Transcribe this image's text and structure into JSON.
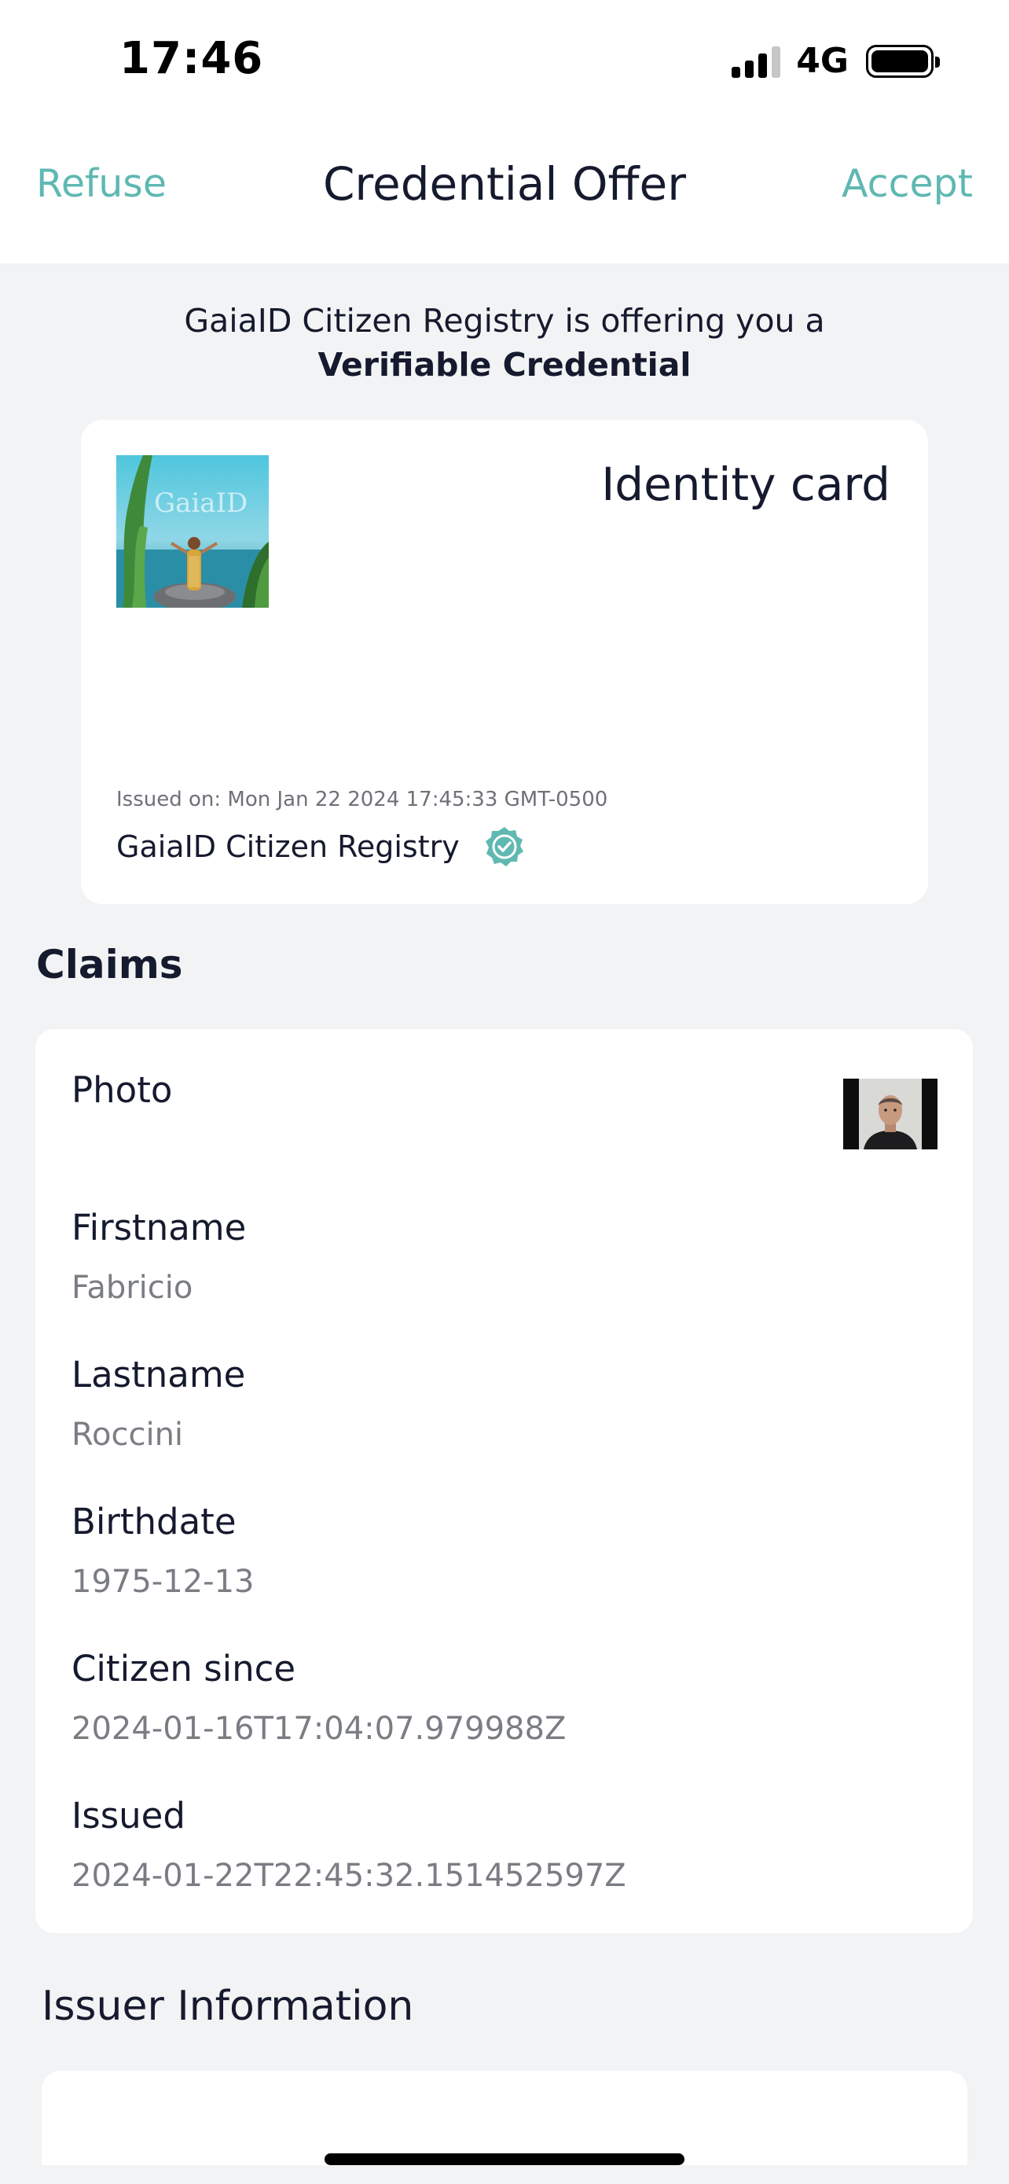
{
  "status_bar": {
    "time": "17:46",
    "network": "4G"
  },
  "nav": {
    "refuse": "Refuse",
    "title": "Credential Offer",
    "accept": "Accept"
  },
  "offer": {
    "line1": "GaiaID Citizen Registry is offering you a",
    "line2": "Verifiable Credential"
  },
  "credential": {
    "logo_text": "GaiaID",
    "title": "Identity card",
    "issued_on": "Issued on: Mon Jan 22 2024 17:45:33 GMT-0500",
    "issuer": "GaiaID Citizen Registry",
    "verified_icon": "verified-badge-icon"
  },
  "claims": {
    "heading": "Claims",
    "items": [
      {
        "label": "Photo"
      },
      {
        "label": "Firstname",
        "value": "Fabricio"
      },
      {
        "label": "Lastname",
        "value": "Roccini"
      },
      {
        "label": "Birthdate",
        "value": "1975-12-13"
      },
      {
        "label": "Citizen since",
        "value": "2024-01-16T17:04:07.979988Z"
      },
      {
        "label": "Issued",
        "value": "2024-01-22T22:45:32.151452597Z"
      }
    ]
  },
  "issuer_info": {
    "heading": "Issuer Information"
  },
  "colors": {
    "accent": "#5fb8b2",
    "text": "#151a2e",
    "muted": "#7b7d84",
    "background": "#f2f3f4"
  }
}
